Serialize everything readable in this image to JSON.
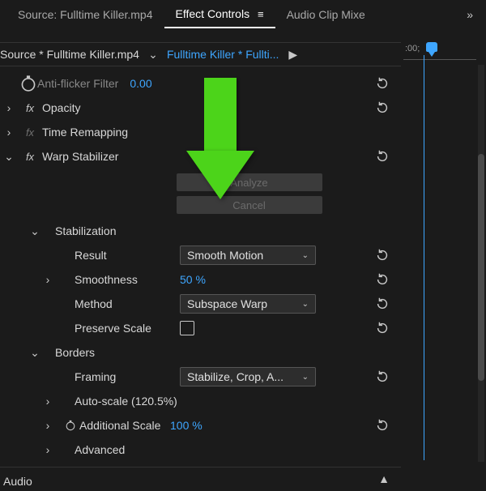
{
  "tabs": {
    "source": "Source: Fulltime Killer.mp4",
    "effect_controls": "Effect Controls",
    "audio_mixer": "Audio Clip Mixe"
  },
  "header": {
    "source_path": "Source * Fulltime Killer.mp4",
    "clip_path": "Fulltime Killer * Fullti...",
    "timecode": ":00;"
  },
  "effects": {
    "anti_flicker": {
      "label": "Anti-flicker Filter",
      "value": "0.00"
    },
    "opacity": {
      "label": "Opacity"
    },
    "time_remap": {
      "label": "Time Remapping"
    },
    "warp": {
      "label": "Warp Stabilizer"
    }
  },
  "warp_buttons": {
    "analyze": "Analyze",
    "cancel": "Cancel"
  },
  "stabilization": {
    "section": "Stabilization",
    "result": {
      "label": "Result",
      "value": "Smooth Motion"
    },
    "smoothness": {
      "label": "Smoothness",
      "value": "50 %"
    },
    "method": {
      "label": "Method",
      "value": "Subspace Warp"
    },
    "preserve_scale": {
      "label": "Preserve Scale"
    }
  },
  "borders": {
    "section": "Borders",
    "framing": {
      "label": "Framing",
      "value": "Stabilize, Crop, A..."
    },
    "auto_scale": {
      "label": "Auto-scale (120.5%)"
    },
    "additional_scale": {
      "label": "Additional Scale",
      "value": "100 %"
    },
    "advanced": {
      "label": "Advanced"
    }
  },
  "audio": {
    "label": "Audio"
  }
}
